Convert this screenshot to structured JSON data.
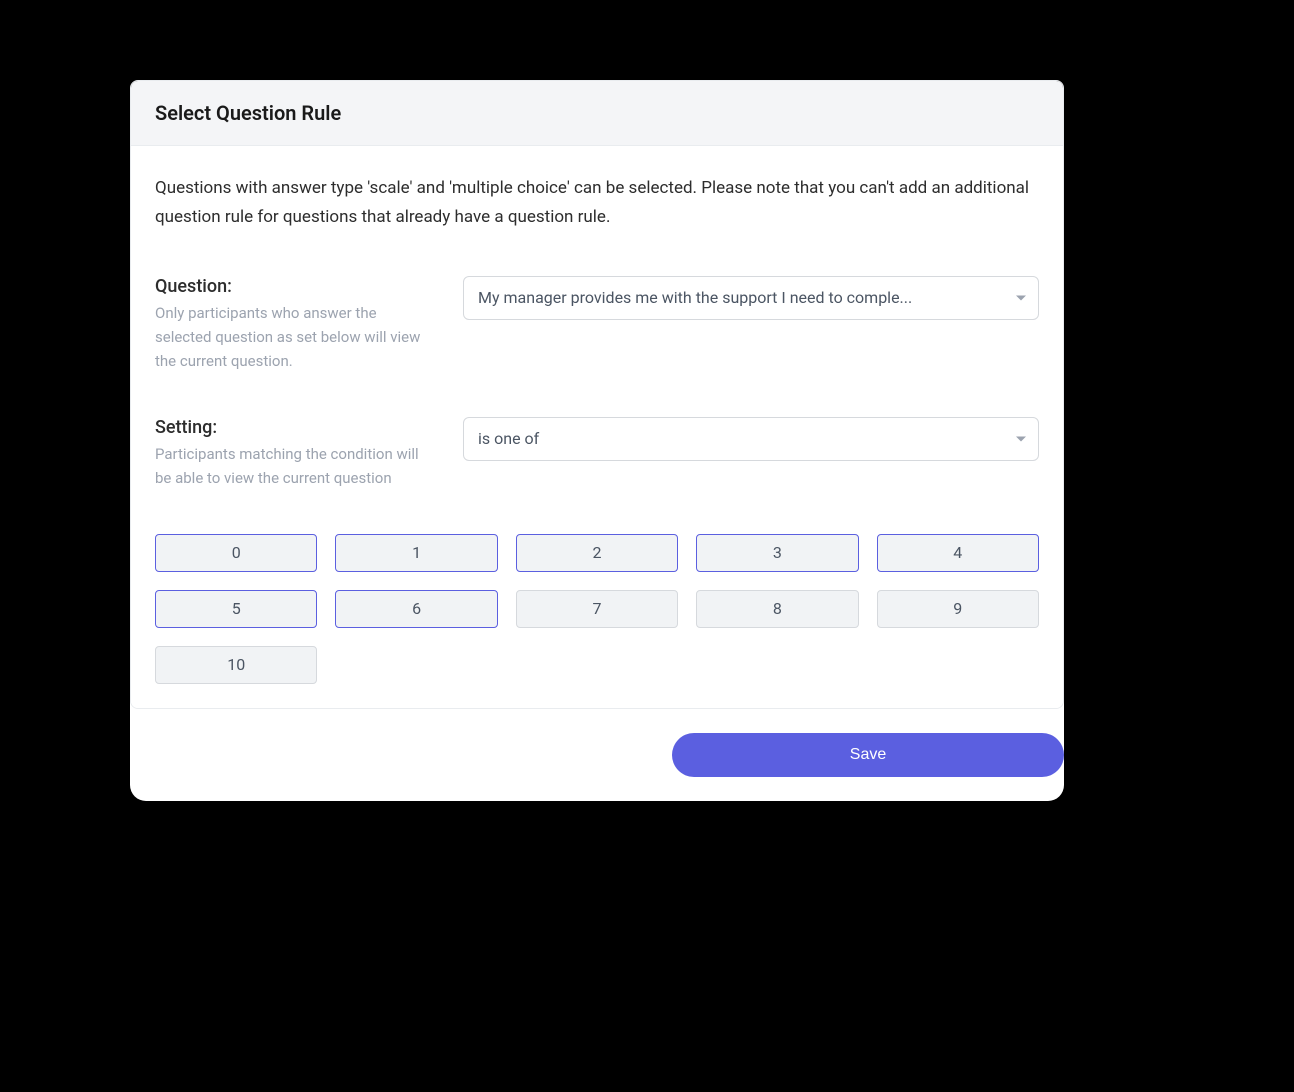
{
  "header": {
    "title": "Select Question Rule"
  },
  "description": "Questions with answer type 'scale' and 'multiple choice' can be selected. Please note that you can't add an additional question rule for questions that already have a question rule.",
  "question": {
    "label": "Question:",
    "help": "Only participants who answer the selected question as set below will view the current question.",
    "selected": "My manager provides me with the support I need to comple..."
  },
  "setting": {
    "label": "Setting:",
    "help": "Participants matching the condition will be able to view the current question",
    "selected": "is one of"
  },
  "options": [
    {
      "label": "0",
      "selected": true
    },
    {
      "label": "1",
      "selected": true
    },
    {
      "label": "2",
      "selected": true
    },
    {
      "label": "3",
      "selected": true
    },
    {
      "label": "4",
      "selected": true
    },
    {
      "label": "5",
      "selected": true
    },
    {
      "label": "6",
      "selected": true
    },
    {
      "label": "7",
      "selected": false
    },
    {
      "label": "8",
      "selected": false
    },
    {
      "label": "9",
      "selected": false
    },
    {
      "label": "10",
      "selected": false
    }
  ],
  "actions": {
    "save": "Save"
  }
}
